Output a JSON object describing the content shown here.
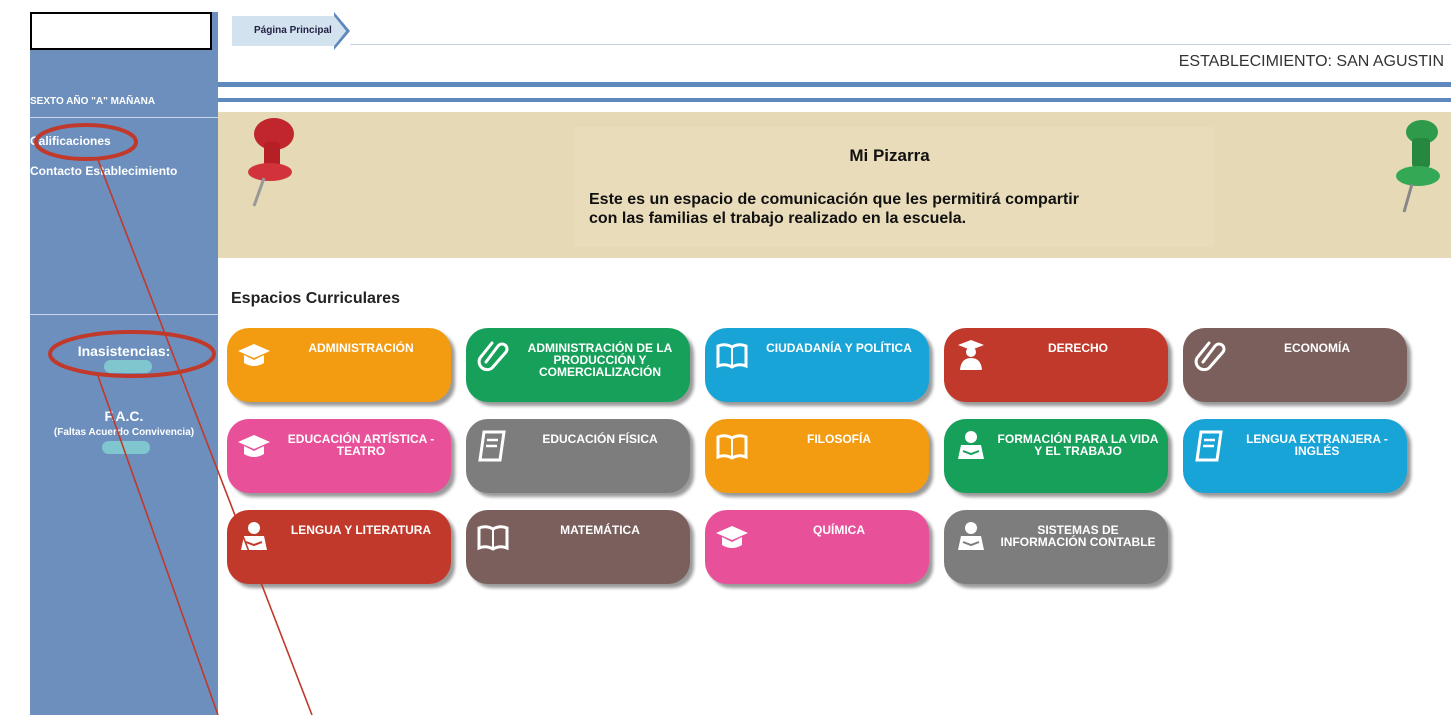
{
  "breadcrumb": {
    "label": "Página Principal"
  },
  "header": {
    "establishment": "ESTABLECIMIENTO: SAN AGUSTIN"
  },
  "sidebar": {
    "course": "SEXTO AÑO \"A\" MAÑANA",
    "items": [
      {
        "label": "Calificaciones"
      },
      {
        "label": "Contacto Establecimiento"
      }
    ],
    "absences": {
      "title": "Inasistencias:"
    },
    "fac": {
      "title": "F.A.C.",
      "subtitle": "(Faltas Acuerdo Convivencia)"
    }
  },
  "pizarra": {
    "title": "Mi Pizarra",
    "line1": "Este es un espacio de comunicación que les permitirá compartir",
    "line2": "con las familias el trabajo realizado en la escuela."
  },
  "curricular": {
    "title": "Espacios Curriculares",
    "subjects": [
      {
        "label": "ADMINISTRACIÓN",
        "color": "#f39c12",
        "icon": "graduation-cap-icon"
      },
      {
        "label": "ADMINISTRACIÓN DE LA PRODUCCIÓN Y COMERCIALIZACIÓN",
        "color": "#16a05a",
        "icon": "paperclip-icon"
      },
      {
        "label": "CIUDADANÍA Y POLÍTICA",
        "color": "#18a4d6",
        "icon": "open-book-icon"
      },
      {
        "label": "DERECHO",
        "color": "#c0392b",
        "icon": "graduate-student-icon"
      },
      {
        "label": "ECONOMÍA",
        "color": "#7a5f5c",
        "icon": "paperclip-icon"
      },
      {
        "label": "EDUCACIÓN ARTÍSTICA - TEATRO",
        "color": "#e8519a",
        "icon": "graduation-cap-icon"
      },
      {
        "label": "EDUCACIÓN FÍSICA",
        "color": "#7d7d7d",
        "icon": "notebook-icon"
      },
      {
        "label": "FILOSOFÍA",
        "color": "#f39c12",
        "icon": "open-book-icon"
      },
      {
        "label": "FORMACIÓN PARA LA VIDA Y EL TRABAJO",
        "color": "#16a05a",
        "icon": "reader-icon"
      },
      {
        "label": "LENGUA EXTRANJERA - INGLÉS",
        "color": "#18a4d6",
        "icon": "notebook-icon"
      },
      {
        "label": "LENGUA Y LITERATURA",
        "color": "#c0392b",
        "icon": "reader-icon"
      },
      {
        "label": "MATEMÁTICA",
        "color": "#7a5f5c",
        "icon": "open-book-icon"
      },
      {
        "label": "QUÍMICA",
        "color": "#e8519a",
        "icon": "graduation-cap-icon"
      },
      {
        "label": "SISTEMAS DE INFORMACIÓN CONTABLE",
        "color": "#7d7d7d",
        "icon": "reader-icon"
      }
    ]
  }
}
